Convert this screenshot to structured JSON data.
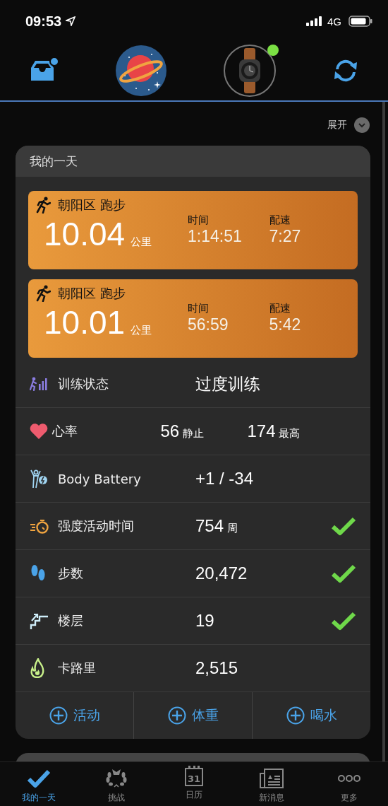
{
  "status_bar": {
    "time": "09:53",
    "network": "4G"
  },
  "header": {
    "inbox_notification": true,
    "device_connected": true
  },
  "expand": {
    "label": "展开"
  },
  "day_card": {
    "title": "我的一天",
    "activities": [
      {
        "title": "朝阳区 跑步",
        "distance": "10.04",
        "distance_unit": "公里",
        "time_label": "时间",
        "time": "1:14:51",
        "pace_label": "配速",
        "pace": "7:27"
      },
      {
        "title": "朝阳区 跑步",
        "distance": "10.01",
        "distance_unit": "公里",
        "time_label": "时间",
        "time": "56:59",
        "pace_label": "配速",
        "pace": "5:42"
      }
    ],
    "rows": [
      {
        "kind": "training",
        "label": "训练状态",
        "value": "过度训练",
        "goal_met": false
      },
      {
        "kind": "heart",
        "label": "心率",
        "value": "56",
        "unit": "静止",
        "value2": "174",
        "unit2": "最高",
        "goal_met": false
      },
      {
        "kind": "battery",
        "label": "Body Battery",
        "value": "+1 / -34",
        "goal_met": false
      },
      {
        "kind": "intensity",
        "label": "强度活动时间",
        "value": "754",
        "unit": "周",
        "goal_met": true
      },
      {
        "kind": "steps",
        "label": "步数",
        "value": "20,472",
        "goal_met": true
      },
      {
        "kind": "floors",
        "label": "楼层",
        "value": "19",
        "goal_met": true
      },
      {
        "kind": "calories",
        "label": "卡路里",
        "value": "2,515",
        "goal_met": false
      }
    ],
    "actions": [
      "活动",
      "体重",
      "喝水"
    ]
  },
  "tab_bar": [
    {
      "kind": "day",
      "label": "我的一天",
      "selected": true
    },
    {
      "kind": "challenge",
      "label": "挑战",
      "selected": false
    },
    {
      "kind": "calendar",
      "label": "日历",
      "selected": false,
      "icon_text": "31"
    },
    {
      "kind": "news",
      "label": "新消息",
      "selected": false
    },
    {
      "kind": "more",
      "label": "更多",
      "selected": false
    }
  ]
}
